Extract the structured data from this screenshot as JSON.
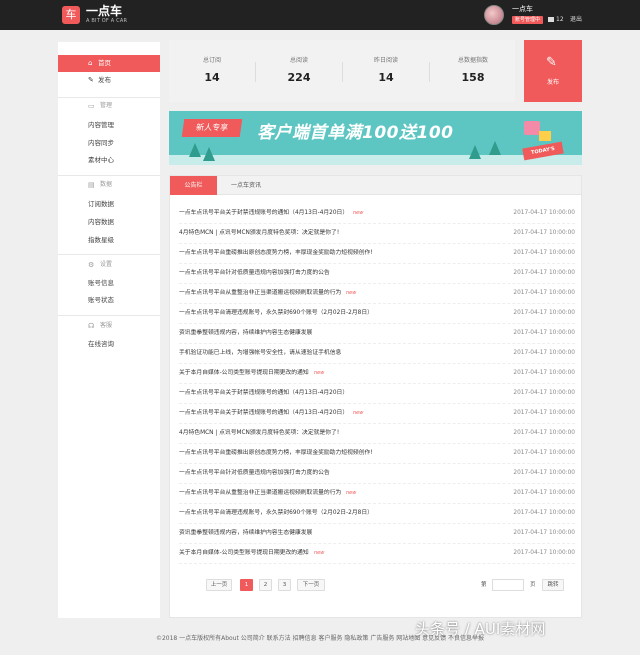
{
  "header": {
    "logo_mark": "车",
    "title": "一点车",
    "subtitle": "A BIT OF A CAR",
    "username": "一点车",
    "badge": "账号管理中",
    "message_count": "12",
    "logout": "退出"
  },
  "sidebar": {
    "home": "首页",
    "publish": "发布",
    "manage_head": "管理",
    "manage_items": [
      "内容管理",
      "内容同步",
      "素材中心"
    ],
    "data_head": "数据",
    "data_items": [
      "订阅数据",
      "内容数据",
      "指数星级"
    ],
    "settings_head": "设置",
    "settings_items": [
      "账号信息",
      "账号状态"
    ],
    "service_head": "客服",
    "service_items": [
      "在线咨询"
    ]
  },
  "stats": [
    {
      "label": "总订阅",
      "value": "14"
    },
    {
      "label": "总阅读",
      "value": "224"
    },
    {
      "label": "昨日阅读",
      "value": "14"
    },
    {
      "label": "总数据指数",
      "value": "158"
    }
  ],
  "publish_button": "发布",
  "banner": {
    "tag": "新人专享",
    "text": "客户端首单满100送100",
    "badge": "TODAY'S"
  },
  "tabs": [
    "公告栏",
    "一点车资讯"
  ],
  "news": [
    {
      "title": "一点车点讯号平台关于封禁违规账号的通知（4月13日-4月20日）",
      "new": "new",
      "date": "2017-04-17 10:00:00"
    },
    {
      "title": "4月特色MCN | 点讯号MCN颁发月度特色奖项：决定就是你了!",
      "new": "",
      "date": "2017-04-17 10:00:00"
    },
    {
      "title": "一点车点讯号平台重磅推出原创态度势力榜，丰厚现金奖励助力短视频创作!",
      "new": "",
      "date": "2017-04-17 10:00:00"
    },
    {
      "title": "一点车点讯号平台针对低质量违规内容加强打击力度的公告",
      "new": "",
      "date": "2017-04-17 10:00:00"
    },
    {
      "title": "一点车点讯号平台从重整治非正当渠道搬运视频刷取流量的行为",
      "new": "new",
      "date": "2017-04-17 10:00:00"
    },
    {
      "title": "一点车点讯号平台清理违规账号，永久禁封690个账号（2月02日-2月8日）",
      "new": "",
      "date": "2017-04-17 10:00:00"
    },
    {
      "title": "资讯重拳整顿违规内容，持续维护内容生态健康发展",
      "new": "",
      "date": "2017-04-17 10:00:00"
    },
    {
      "title": "手机验证功能已上线，为增强帐号安全性，请从速验证手机信息",
      "new": "",
      "date": "2017-04-17 10:00:00"
    },
    {
      "title": "关于本月自媒体-公司类型账号提现日期更改的通知",
      "new": "new",
      "date": "2017-04-17 10:00:00"
    },
    {
      "title": "一点车点讯号平台关于封禁违规账号的通知（4月13日-4月20日）",
      "new": "",
      "date": "2017-04-17 10:00:00"
    },
    {
      "title": "一点车点讯号平台关于封禁违规账号的通知（4月13日-4月20日）",
      "new": "new",
      "date": "2017-04-17 10:00:00"
    },
    {
      "title": "4月特色MCN | 点讯号MCN颁发月度特色奖项：决定就是你了!",
      "new": "",
      "date": "2017-04-17 10:00:00"
    },
    {
      "title": "一点车点讯号平台重磅推出原创态度势力榜，丰厚现金奖励助力短视频创作!",
      "new": "",
      "date": "2017-04-17 10:00:00"
    },
    {
      "title": "一点车点讯号平台针对低质量违规内容加强打击力度的公告",
      "new": "",
      "date": "2017-04-17 10:00:00"
    },
    {
      "title": "一点车点讯号平台从重整治非正当渠道搬运视频刷取流量的行为",
      "new": "new",
      "date": "2017-04-17 10:00:00"
    },
    {
      "title": "一点车点讯号平台清理违规账号，永久禁封690个账号（2月02日-2月8日）",
      "new": "",
      "date": "2017-04-17 10:00:00"
    },
    {
      "title": "资讯重拳整顿违规内容，持续维护内容生态健康发展",
      "new": "",
      "date": "2017-04-17 10:00:00"
    },
    {
      "title": "关于本月自媒体-公司类型账号提现日期更改的通知",
      "new": "new",
      "date": "2017-04-17 10:00:00"
    }
  ],
  "pagination": {
    "prev": "上一页",
    "pages": [
      "1",
      "2",
      "3"
    ],
    "next": "下一页",
    "goto_prefix": "第",
    "goto_suffix": "页",
    "jump": "跳转"
  },
  "footer": "©2018 一点车版权所有About 公司简介 联系方法 招聘信息 客户服务 隐私政策 广告服务 网站地图 意见反馈 不良信息举报",
  "watermark": "头条号 / AUI素材网",
  "colors": {
    "accent": "#f05a5a",
    "topbar": "#222222",
    "banner": "#5ec6c2"
  }
}
